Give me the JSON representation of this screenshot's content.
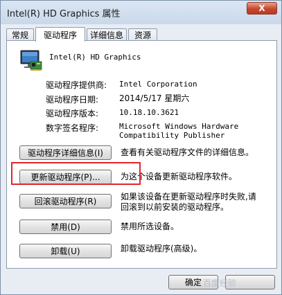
{
  "window": {
    "title": "Intel(R) HD Graphics 属性",
    "close_label": "X"
  },
  "tabs": [
    {
      "label": "常规"
    },
    {
      "label": "驱动程序"
    },
    {
      "label": "详细信息"
    },
    {
      "label": "资源"
    }
  ],
  "device": {
    "name": "Intel(R) HD Graphics",
    "icon": "display-adapter-icon"
  },
  "properties": {
    "provider_label": "驱动程序提供商:",
    "provider_value": "Intel Corporation",
    "date_label": "驱动程序日期:",
    "date_value": "2014/5/17 星期六",
    "version_label": "驱动程序版本:",
    "version_value": "10.18.10.3621",
    "signer_label": "数字签名程序:",
    "signer_value_line1": "Microsoft Windows Hardware",
    "signer_value_line2": "Compatibility Publisher"
  },
  "actions": {
    "details_label": "驱动程序详细信息(I)",
    "details_desc": "查看有关驱动程序文件的详细信息。",
    "update_label": "更新驱动程序(P)...",
    "update_desc": "为这个设备更新驱动程序软件。",
    "rollback_label": "回滚驱动程序(R)",
    "rollback_desc_line1": "如果该设备在更新驱动程序时失败,请",
    "rollback_desc_line2": "回滚到以前安装的驱动程序。",
    "disable_label": "禁用(D)",
    "disable_desc": "禁用所选设备。",
    "uninstall_label": "卸载(U)",
    "uninstall_desc": "卸载驱动程序(高级)。"
  },
  "footer": {
    "ok_label": "确定",
    "watermark": "百度经验"
  },
  "colors": {
    "highlight": "#e0252a",
    "close_button": "#c8472d"
  }
}
